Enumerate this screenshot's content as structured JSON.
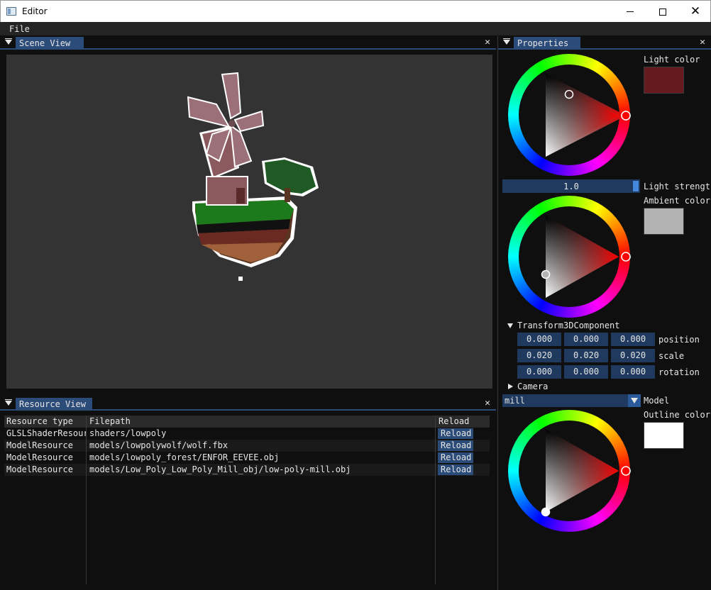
{
  "window": {
    "title": "Editor"
  },
  "menu": {
    "file": "File"
  },
  "scene_view": {
    "tab_label": "Scene View",
    "close": "✕"
  },
  "resource_view": {
    "tab_label": "Resource View",
    "close": "✕",
    "columns": [
      "Resource type",
      "Filepath",
      "Reload"
    ],
    "rows": [
      {
        "type": "GLSLShaderResourc",
        "path": "shaders/lowpoly",
        "action": "Reload"
      },
      {
        "type": "ModelResource",
        "path": "models/lowpolywolf/wolf.fbx",
        "action": "Reload"
      },
      {
        "type": "ModelResource",
        "path": "models/lowpoly_forest/ENFOR_EEVEE.obj",
        "action": "Reload"
      },
      {
        "type": "ModelResource",
        "path": "models/Low_Poly_Low_Poly_Mill_obj/low-poly-mill.obj",
        "action": "Reload"
      }
    ]
  },
  "properties": {
    "tab_label": "Properties",
    "close": "✕",
    "light_color": {
      "label": "Light color",
      "color": "#651a1f"
    },
    "light_strength": {
      "label": "Light strengt",
      "value": "1.0",
      "fraction": 1.0
    },
    "ambient_color": {
      "label": "Ambient color",
      "color": "#b3b3b3"
    },
    "transform": {
      "header": "Transform3DComponent",
      "position": {
        "label": "position",
        "values": [
          "0.000",
          "0.000",
          "0.000"
        ]
      },
      "scale": {
        "label": "scale",
        "values": [
          "0.020",
          "0.020",
          "0.020"
        ]
      },
      "rotation": {
        "label": "rotation",
        "values": [
          "0.000",
          "0.000",
          "0.000"
        ]
      }
    },
    "camera": {
      "header": "Camera"
    },
    "model": {
      "label": "Model",
      "value": "mill"
    },
    "outline_color": {
      "label": "Outline color",
      "color": "#ffffff"
    }
  }
}
